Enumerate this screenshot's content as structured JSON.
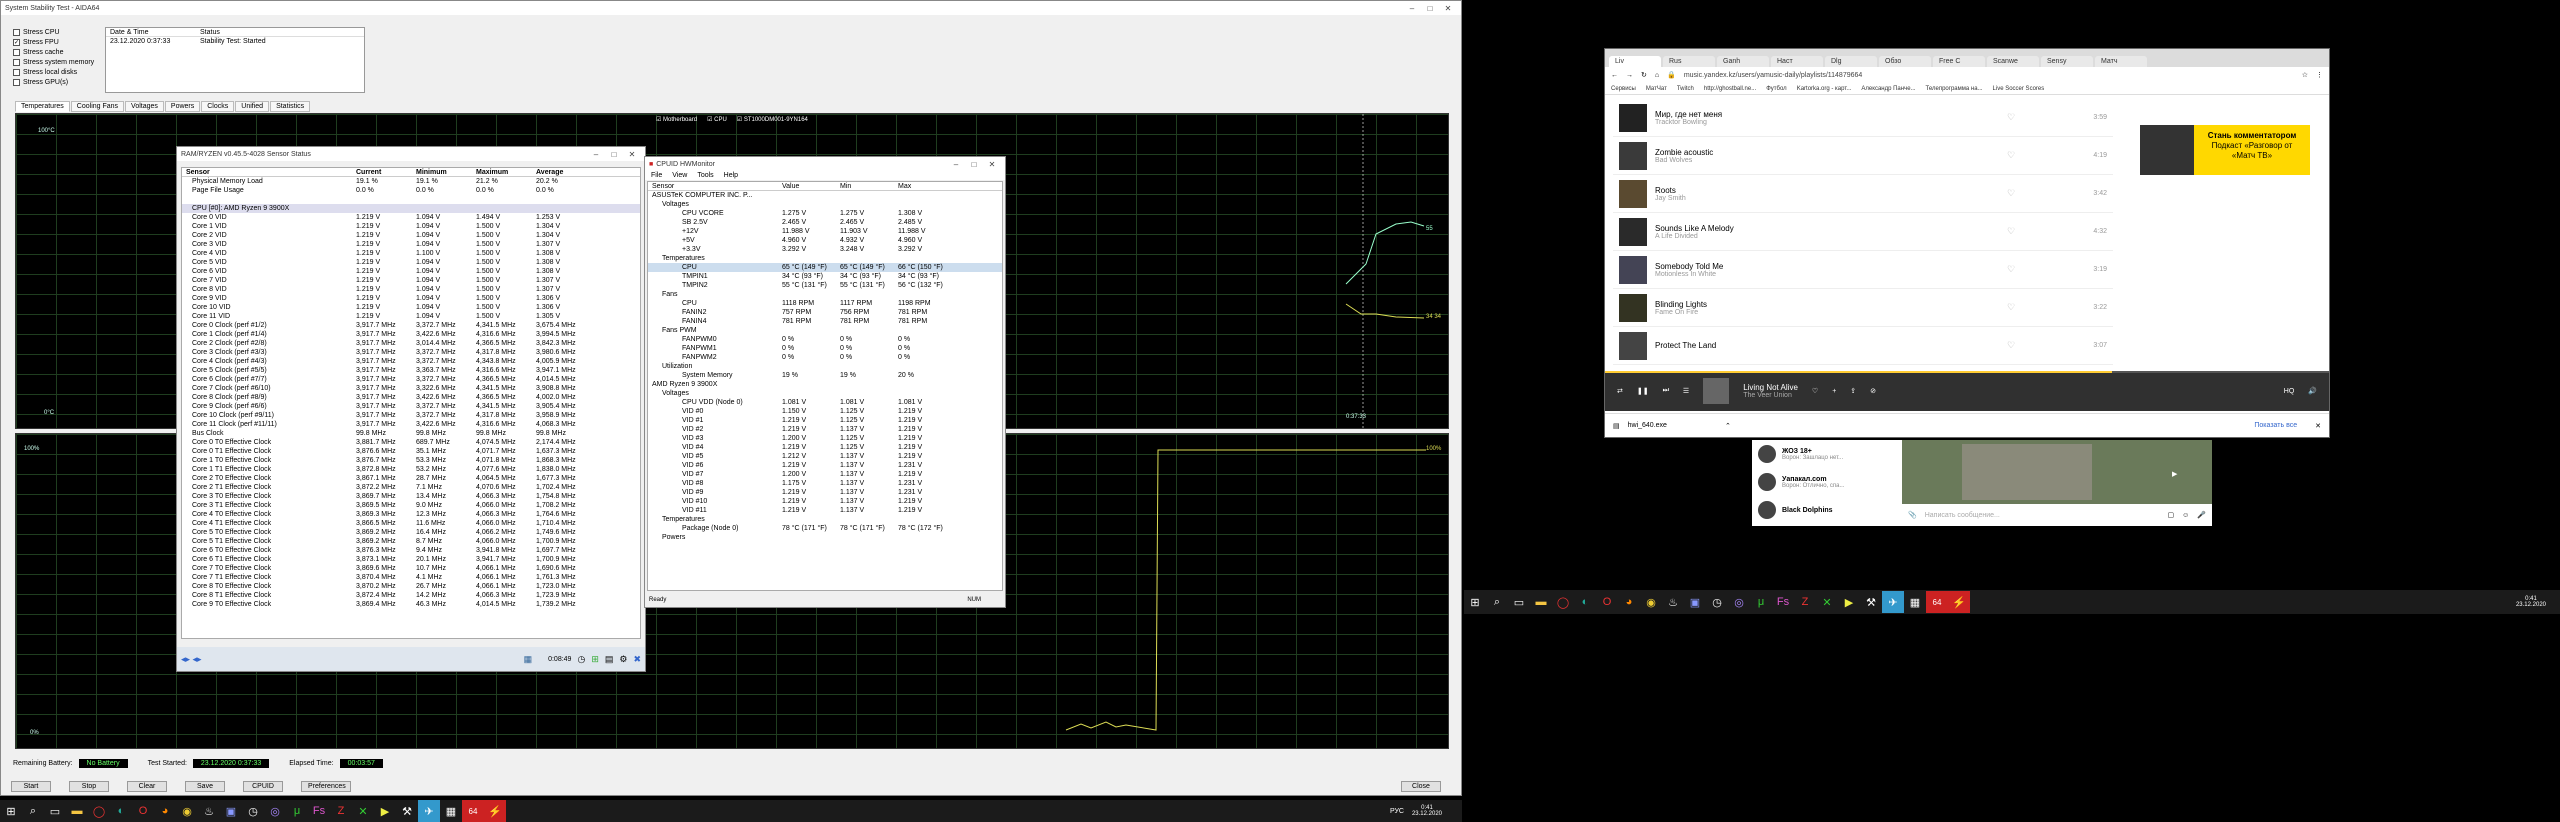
{
  "aida": {
    "title": "System Stability Test - AIDA64",
    "stress": [
      "Stress CPU",
      "Stress FPU",
      "Stress cache",
      "Stress system memory",
      "Stress local disks",
      "Stress GPU(s)"
    ],
    "stress_checked": [
      false,
      true,
      false,
      false,
      false,
      false
    ],
    "log_headers": [
      "Date & Time",
      "Status"
    ],
    "log_row": [
      "23.12.2020 0:37:33",
      "Stability Test: Started"
    ],
    "tabs": [
      "Temperatures",
      "Cooling Fans",
      "Voltages",
      "Powers",
      "Clocks",
      "Unified",
      "Statistics"
    ],
    "legend": [
      "Motherboard",
      "CPU",
      "ST1000DM001-9YN164"
    ],
    "top_graph": {
      "ymax": "100°C",
      "ymin": "0°C",
      "time": "0:37:33",
      "val1": "55",
      "val2": "34 34"
    },
    "bot_graph": {
      "ymax": "100%",
      "ymin": "0%",
      "right": "100%"
    },
    "footer": {
      "battery_label": "Remaining Battery:",
      "battery": "No Battery",
      "started_label": "Test Started:",
      "started": "23.12.2020 0:37:33",
      "elapsed_label": "Elapsed Time:",
      "elapsed": "00:03:57"
    },
    "buttons": [
      "Start",
      "Stop",
      "Clear",
      "Save",
      "CPUID",
      "Preferences"
    ],
    "close": "Close"
  },
  "ryzen": {
    "title": "RAM/RYZEN v0.45.5-4028 Sensor Status",
    "headers": [
      "Sensor",
      "Current",
      "Minimum",
      "Maximum",
      "Average"
    ],
    "rows": [
      [
        "Physical Memory Load",
        "19.1 %",
        "19.1 %",
        "21.2 %",
        "20.2 %"
      ],
      [
        "Page File Usage",
        "0.0 %",
        "0.0 %",
        "0.0 %",
        "0.0 %"
      ],
      [
        "",
        "",
        "",
        "",
        ""
      ],
      [
        "CPU [#0]: AMD Ryzen 9 3900X",
        "",
        "",
        "",
        ""
      ],
      [
        "Core 0 VID",
        "1.219 V",
        "1.094 V",
        "1.494 V",
        "1.253 V"
      ],
      [
        "Core 1 VID",
        "1.219 V",
        "1.094 V",
        "1.500 V",
        "1.304 V"
      ],
      [
        "Core 2 VID",
        "1.219 V",
        "1.094 V",
        "1.500 V",
        "1.304 V"
      ],
      [
        "Core 3 VID",
        "1.219 V",
        "1.094 V",
        "1.500 V",
        "1.307 V"
      ],
      [
        "Core 4 VID",
        "1.219 V",
        "1.100 V",
        "1.500 V",
        "1.308 V"
      ],
      [
        "Core 5 VID",
        "1.219 V",
        "1.094 V",
        "1.500 V",
        "1.308 V"
      ],
      [
        "Core 6 VID",
        "1.219 V",
        "1.094 V",
        "1.500 V",
        "1.308 V"
      ],
      [
        "Core 7 VID",
        "1.219 V",
        "1.094 V",
        "1.500 V",
        "1.307 V"
      ],
      [
        "Core 8 VID",
        "1.219 V",
        "1.094 V",
        "1.500 V",
        "1.307 V"
      ],
      [
        "Core 9 VID",
        "1.219 V",
        "1.094 V",
        "1.500 V",
        "1.306 V"
      ],
      [
        "Core 10 VID",
        "1.219 V",
        "1.094 V",
        "1.500 V",
        "1.306 V"
      ],
      [
        "Core 11 VID",
        "1.219 V",
        "1.094 V",
        "1.500 V",
        "1.305 V"
      ],
      [
        "Core 0 Clock (perf #1/2)",
        "3,917.7 MHz",
        "3,372.7 MHz",
        "4,341.5 MHz",
        "3,675.4 MHz"
      ],
      [
        "Core 1 Clock (perf #1/4)",
        "3,917.7 MHz",
        "3,422.6 MHz",
        "4,316.6 MHz",
        "3,994.5 MHz"
      ],
      [
        "Core 2 Clock (perf #2/8)",
        "3,917.7 MHz",
        "3,014.4 MHz",
        "4,366.5 MHz",
        "3,842.3 MHz"
      ],
      [
        "Core 3 Clock (perf #3/3)",
        "3,917.7 MHz",
        "3,372.7 MHz",
        "4,317.8 MHz",
        "3,980.6 MHz"
      ],
      [
        "Core 4 Clock (perf #4/3)",
        "3,917.7 MHz",
        "3,372.7 MHz",
        "4,343.8 MHz",
        "4,005.9 MHz"
      ],
      [
        "Core 5 Clock (perf #5/5)",
        "3,917.7 MHz",
        "3,363.7 MHz",
        "4,316.6 MHz",
        "3,947.1 MHz"
      ],
      [
        "Core 6 Clock (perf #7/7)",
        "3,917.7 MHz",
        "3,372.7 MHz",
        "4,366.5 MHz",
        "4,014.5 MHz"
      ],
      [
        "Core 7 Clock (perf #6/10)",
        "3,917.7 MHz",
        "3,322.6 MHz",
        "4,341.5 MHz",
        "3,908.8 MHz"
      ],
      [
        "Core 8 Clock (perf #8/9)",
        "3,917.7 MHz",
        "3,422.6 MHz",
        "4,366.5 MHz",
        "4,002.0 MHz"
      ],
      [
        "Core 9 Clock (perf #6/6)",
        "3,917.7 MHz",
        "3,372.7 MHz",
        "4,341.5 MHz",
        "3,905.4 MHz"
      ],
      [
        "Core 10 Clock (perf #9/11)",
        "3,917.7 MHz",
        "3,372.7 MHz",
        "4,317.8 MHz",
        "3,958.9 MHz"
      ],
      [
        "Core 11 Clock (perf #11/11)",
        "3,917.7 MHz",
        "3,422.6 MHz",
        "4,316.6 MHz",
        "4,068.3 MHz"
      ],
      [
        "Bus Clock",
        "99.8 MHz",
        "99.8 MHz",
        "99.8 MHz",
        "99.8 MHz"
      ],
      [
        "Core 0 T0 Effective Clock",
        "3,881.7 MHz",
        "689.7 MHz",
        "4,074.5 MHz",
        "2,174.4 MHz"
      ],
      [
        "Core 0 T1 Effective Clock",
        "3,876.6 MHz",
        "35.1 MHz",
        "4,071.7 MHz",
        "1,637.3 MHz"
      ],
      [
        "Core 1 T0 Effective Clock",
        "3,876.7 MHz",
        "53.3 MHz",
        "4,071.8 MHz",
        "1,868.3 MHz"
      ],
      [
        "Core 1 T1 Effective Clock",
        "3,872.8 MHz",
        "53.2 MHz",
        "4,077.6 MHz",
        "1,838.0 MHz"
      ],
      [
        "Core 2 T0 Effective Clock",
        "3,867.1 MHz",
        "28.7 MHz",
        "4,064.5 MHz",
        "1,677.3 MHz"
      ],
      [
        "Core 2 T1 Effective Clock",
        "3,872.2 MHz",
        "7.1 MHz",
        "4,070.6 MHz",
        "1,702.4 MHz"
      ],
      [
        "Core 3 T0 Effective Clock",
        "3,869.7 MHz",
        "13.4 MHz",
        "4,066.3 MHz",
        "1,754.8 MHz"
      ],
      [
        "Core 3 T1 Effective Clock",
        "3,869.5 MHz",
        "9.0 MHz",
        "4,066.0 MHz",
        "1,708.2 MHz"
      ],
      [
        "Core 4 T0 Effective Clock",
        "3,869.3 MHz",
        "12.3 MHz",
        "4,066.3 MHz",
        "1,764.6 MHz"
      ],
      [
        "Core 4 T1 Effective Clock",
        "3,866.5 MHz",
        "11.6 MHz",
        "4,066.0 MHz",
        "1,710.4 MHz"
      ],
      [
        "Core 5 T0 Effective Clock",
        "3,869.2 MHz",
        "16.4 MHz",
        "4,066.2 MHz",
        "1,749.6 MHz"
      ],
      [
        "Core 5 T1 Effective Clock",
        "3,869.2 MHz",
        "8.7 MHz",
        "4,066.0 MHz",
        "1,700.9 MHz"
      ],
      [
        "Core 6 T0 Effective Clock",
        "3,876.3 MHz",
        "9.4 MHz",
        "3,941.8 MHz",
        "1,697.7 MHz"
      ],
      [
        "Core 6 T1 Effective Clock",
        "3,873.1 MHz",
        "20.1 MHz",
        "3,941.7 MHz",
        "1,700.9 MHz"
      ],
      [
        "Core 7 T0 Effective Clock",
        "3,869.6 MHz",
        "10.7 MHz",
        "4,066.1 MHz",
        "1,690.6 MHz"
      ],
      [
        "Core 7 T1 Effective Clock",
        "3,870.4 MHz",
        "4.1 MHz",
        "4,066.1 MHz",
        "1,761.3 MHz"
      ],
      [
        "Core 8 T0 Effective Clock",
        "3,870.2 MHz",
        "26.7 MHz",
        "4,066.1 MHz",
        "1,723.0 MHz"
      ],
      [
        "Core 8 T1 Effective Clock",
        "3,872.4 MHz",
        "14.2 MHz",
        "4,066.3 MHz",
        "1,723.9 MHz"
      ],
      [
        "Core 9 T0 Effective Clock",
        "3,869.4 MHz",
        "46.3 MHz",
        "4,014.5 MHz",
        "1,739.2 MHz"
      ]
    ],
    "timer": "0:08:49"
  },
  "hwmon": {
    "title": "CPUID HWMonitor",
    "menu": [
      "File",
      "View",
      "Tools",
      "Help"
    ],
    "headers": [
      "Sensor",
      "Value",
      "Min",
      "Max"
    ],
    "rows": [
      [
        "ASUSTeK COMPUTER INC. P...",
        "",
        "",
        ""
      ],
      [
        "Voltages",
        "",
        "",
        ""
      ],
      [
        "CPU VCORE",
        "1.275 V",
        "1.275 V",
        "1.308 V"
      ],
      [
        "SB 2.5V",
        "2.465 V",
        "2.465 V",
        "2.485 V"
      ],
      [
        "+12V",
        "11.988 V",
        "11.903 V",
        "11.988 V"
      ],
      [
        "+5V",
        "4.960 V",
        "4.932 V",
        "4.960 V"
      ],
      [
        "+3.3V",
        "3.292 V",
        "3.248 V",
        "3.292 V"
      ],
      [
        "Temperatures",
        "",
        "",
        ""
      ],
      [
        "CPU",
        "65 °C (149 °F)",
        "65 °C (149 °F)",
        "66 °C (150 °F)"
      ],
      [
        "TMPIN1",
        "34 °C (93 °F)",
        "34 °C (93 °F)",
        "34 °C (93 °F)"
      ],
      [
        "TMPIN2",
        "55 °C (131 °F)",
        "55 °C (131 °F)",
        "56 °C (132 °F)"
      ],
      [
        "Fans",
        "",
        "",
        ""
      ],
      [
        "CPU",
        "1118 RPM",
        "1117 RPM",
        "1198 RPM"
      ],
      [
        "FANIN2",
        "757 RPM",
        "756 RPM",
        "781 RPM"
      ],
      [
        "FANIN4",
        "781 RPM",
        "781 RPM",
        "781 RPM"
      ],
      [
        "Fans PWM",
        "",
        "",
        ""
      ],
      [
        "FANPWM0",
        "0 %",
        "0 %",
        "0 %"
      ],
      [
        "FANPWM1",
        "0 %",
        "0 %",
        "0 %"
      ],
      [
        "FANPWM2",
        "0 %",
        "0 %",
        "0 %"
      ],
      [
        "Utilization",
        "",
        "",
        ""
      ],
      [
        "System Memory",
        "19 %",
        "19 %",
        "20 %"
      ],
      [
        "AMD Ryzen 9 3900X",
        "",
        "",
        ""
      ],
      [
        "Voltages",
        "",
        "",
        ""
      ],
      [
        "CPU VDD (Node 0)",
        "1.081 V",
        "1.081 V",
        "1.081 V"
      ],
      [
        "VID #0",
        "1.150 V",
        "1.125 V",
        "1.219 V"
      ],
      [
        "VID #1",
        "1.219 V",
        "1.125 V",
        "1.219 V"
      ],
      [
        "VID #2",
        "1.219 V",
        "1.137 V",
        "1.219 V"
      ],
      [
        "VID #3",
        "1.200 V",
        "1.125 V",
        "1.219 V"
      ],
      [
        "VID #4",
        "1.219 V",
        "1.125 V",
        "1.219 V"
      ],
      [
        "VID #5",
        "1.212 V",
        "1.137 V",
        "1.219 V"
      ],
      [
        "VID #6",
        "1.219 V",
        "1.137 V",
        "1.231 V"
      ],
      [
        "VID #7",
        "1.200 V",
        "1.137 V",
        "1.219 V"
      ],
      [
        "VID #8",
        "1.175 V",
        "1.137 V",
        "1.231 V"
      ],
      [
        "VID #9",
        "1.219 V",
        "1.137 V",
        "1.231 V"
      ],
      [
        "VID #10",
        "1.219 V",
        "1.137 V",
        "1.219 V"
      ],
      [
        "VID #11",
        "1.219 V",
        "1.137 V",
        "1.219 V"
      ],
      [
        "Temperatures",
        "",
        "",
        ""
      ],
      [
        "Package (Node 0)",
        "78 °C (171 °F)",
        "78 °C (171 °F)",
        "78 °C (172 °F)"
      ],
      [
        "Powers",
        "",
        "",
        ""
      ]
    ],
    "status": "Ready",
    "num": "NUM"
  },
  "browser": {
    "url": "music.yandex.kz/users/yamusic-daily/playlists/114879664",
    "tabs": [
      "Liv",
      "Rus",
      "Ganh",
      "Наст",
      "Dlg",
      "Обзо",
      "Free C",
      "Scanwe",
      "Sensy",
      "Матч"
    ],
    "bookmarks": [
      "Сервисы",
      "МатЧат",
      "Twitch",
      "http://ghostball.ne...",
      "Футбол",
      "Kartorka.org - карт...",
      "Александр Панче...",
      "Телепрограмма на...",
      "Live Soccer Scores"
    ],
    "tracks": [
      {
        "title": "Мир, где нет меня",
        "artist": "Tracktor Bowling",
        "dur": "3:59"
      },
      {
        "title": "Zombie acoustic",
        "artist": "Bad Wolves",
        "dur": "4:19"
      },
      {
        "title": "Roots",
        "artist": "Jay Smith",
        "dur": "3:42"
      },
      {
        "title": "Sounds Like A Melody",
        "artist": "A Life Divided",
        "dur": "4:32"
      },
      {
        "title": "Somebody Told Me",
        "artist": "Motionless In White",
        "dur": "3:19"
      },
      {
        "title": "Blinding Lights",
        "artist": "Fame On Fire",
        "dur": "3:22"
      },
      {
        "title": "Protect The Land",
        "artist": "",
        "dur": "3:07"
      }
    ],
    "ad": {
      "line1": "Стань комментатором",
      "line2": "Подкаст «Разговор от",
      "line3": "«Матч ТВ»"
    },
    "player": {
      "title": "Living Not Alive",
      "artist": "The Veer Union",
      "progress": 0.7
    },
    "download": {
      "file": "hwi_640.exe",
      "show_all": "Показать все"
    }
  },
  "telegram": {
    "chats": [
      {
        "name": "ЖОЗ 18+",
        "preview": "Ворон: Зашлацо нет..."
      },
      {
        "name": "Уапакал.com",
        "preview": "Ворон: Отлично, спа..."
      },
      {
        "name": "Black Dolphins",
        "preview": ""
      }
    ],
    "input_placeholder": "Написать сообщение..."
  },
  "taskbar1": {
    "time": "0:41",
    "date": "23.12.2020",
    "lang": "РУС",
    "badge": "64"
  },
  "taskbar2": {
    "time": "0:41",
    "date": "23.12.2020",
    "badge": "64"
  }
}
